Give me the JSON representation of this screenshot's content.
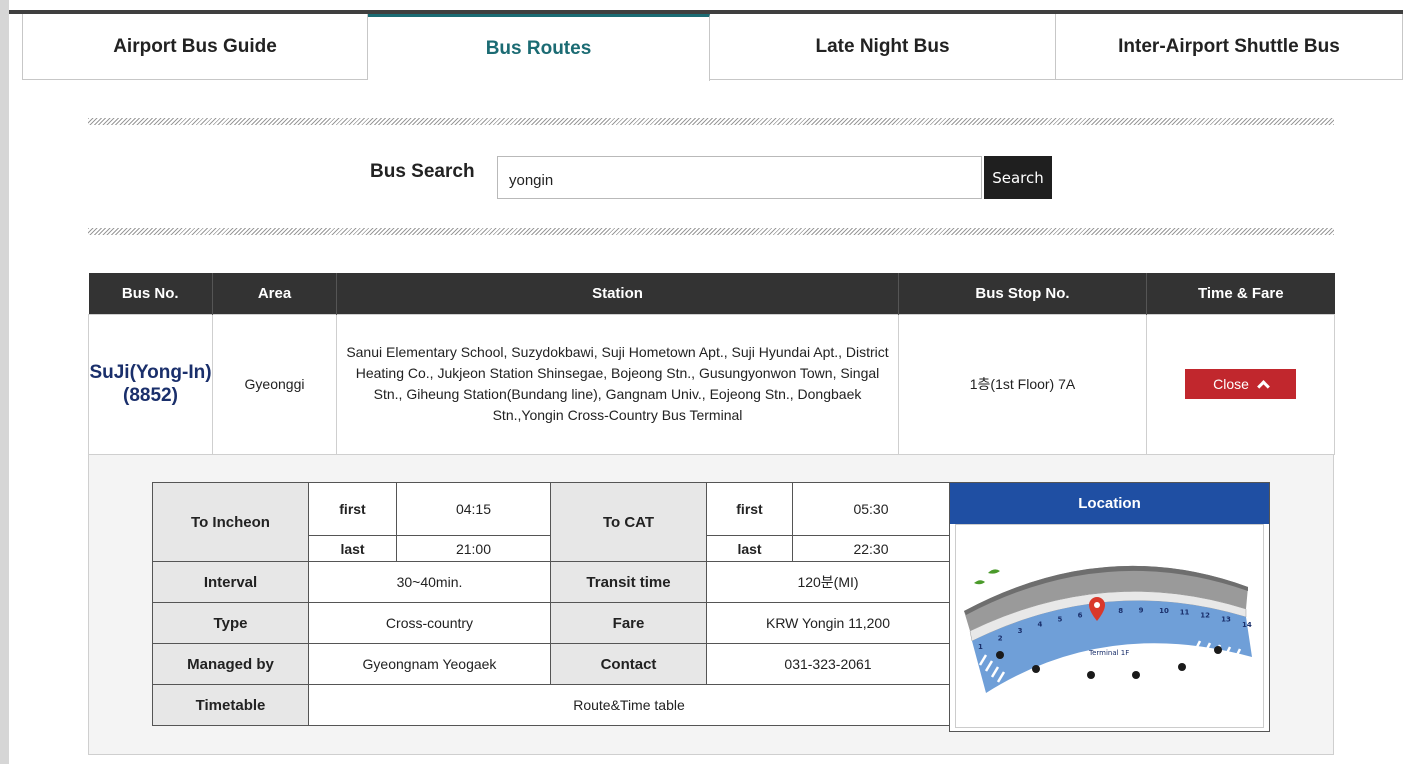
{
  "tabs": [
    {
      "label": "Airport Bus Guide",
      "active": false
    },
    {
      "label": "Bus Routes",
      "active": true
    },
    {
      "label": "Late Night Bus",
      "active": false
    },
    {
      "label": "Inter-Airport Shuttle Bus",
      "active": false
    }
  ],
  "search": {
    "label": "Bus Search",
    "value": "yongin",
    "button": "Search"
  },
  "results": {
    "columns": [
      "Bus No.",
      "Area",
      "Station",
      "Bus Stop No.",
      "Time & Fare"
    ],
    "row": {
      "bus_no": "SuJi(Yong-In)(8852)",
      "area": "Gyeonggi",
      "station": "Sanui Elementary School, Suzydokbawi, Suji Hometown Apt., Suji Hyundai Apt., District Heating Co., Jukjeon Station Shinsegae, Bojeong Stn., Gusungyonwon Town, Singal Stn., Giheung Station(Bundang line), Gangnam Univ., Eojeong Stn., Dongbaek Stn.,Yongin Cross-Country Bus Terminal",
      "bus_stop": "1층(1st Floor) 7A",
      "close_label": "Close"
    }
  },
  "detail": {
    "to_incheon": {
      "label": "To Incheon",
      "first_label": "first",
      "first": "04:15",
      "last_label": "last",
      "last": "21:00"
    },
    "to_cat": {
      "label": "To CAT",
      "first_label": "first",
      "first": "05:30",
      "last_label": "last",
      "last": "22:30"
    },
    "interval": {
      "label": "Interval",
      "value": "30~40min."
    },
    "transit_time": {
      "label": "Transit time",
      "value": "120분(MI)"
    },
    "type": {
      "label": "Type",
      "value": "Cross-country"
    },
    "fare": {
      "label": "Fare",
      "value": "KRW Yongin 11,200"
    },
    "managed_by": {
      "label": "Managed by",
      "value": "Gyeongnam Yeogaek"
    },
    "contact": {
      "label": "Contact",
      "value": "031-323-2061"
    },
    "timetable": {
      "label": "Timetable",
      "value": "Route&Time table"
    },
    "location": {
      "label": "Location",
      "map_label": "Terminal 1F",
      "gate_numbers": [
        "1",
        "2",
        "3",
        "4",
        "5",
        "6",
        "7",
        "8",
        "9",
        "10",
        "11",
        "12",
        "13",
        "14"
      ],
      "pin_color": "#d9382b",
      "lane_color": "#6f9fd8"
    }
  },
  "colors": {
    "active_tab": "#1b6b73",
    "table_header": "#333333",
    "close_button": "#c1272d",
    "location_header": "#1f4fa3",
    "bus_no_text": "#1a2f6b"
  }
}
